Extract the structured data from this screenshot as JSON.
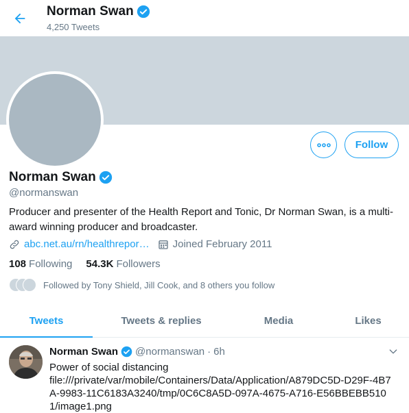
{
  "header": {
    "name": "Norman Swan",
    "tweet_count": "4,250 Tweets"
  },
  "profile": {
    "name": "Norman Swan",
    "handle": "@normanswan",
    "bio": "Producer and presenter of the Health Report and Tonic, Dr Norman Swan, is a multi-award winning producer and broadcaster.",
    "link": "abc.net.au/rn/healthrepor…",
    "joined": "Joined February 2011",
    "following_count": "108",
    "following_label": "Following",
    "followers_count": "54.3K",
    "followers_label": "Followers",
    "followed_by": "Followed by Tony Shield, Jill Cook, and 8 others you follow",
    "follow_button": "Follow"
  },
  "tabs": [
    {
      "label": "Tweets",
      "active": true
    },
    {
      "label": "Tweets & replies",
      "active": false
    },
    {
      "label": "Media",
      "active": false
    },
    {
      "label": "Likes",
      "active": false
    }
  ],
  "tweet": {
    "name": "Norman Swan",
    "handle": "@normanswan",
    "dot": "·",
    "time": "6h",
    "text_line1": "Power of social distancing",
    "text_line2": "file:///private/var/mobile/Containers/Data/Application/A879DC5D-D29F-4B7A-9983-11C6183A3240/tmp/0C6C8A5D-097A-4675-A716-E56BBEBB5101/image1.png"
  },
  "colors": {
    "accent": "#1da1f2",
    "banner": "#ccd6dd",
    "avatar_placeholder": "#aab8c2",
    "secondary_text": "#657786"
  },
  "icons": {
    "back": "arrow-left-icon",
    "verified": "verified-badge-icon",
    "more": "more-horizontal-icon",
    "link": "link-icon",
    "calendar": "calendar-icon",
    "caret": "chevron-down-icon"
  }
}
